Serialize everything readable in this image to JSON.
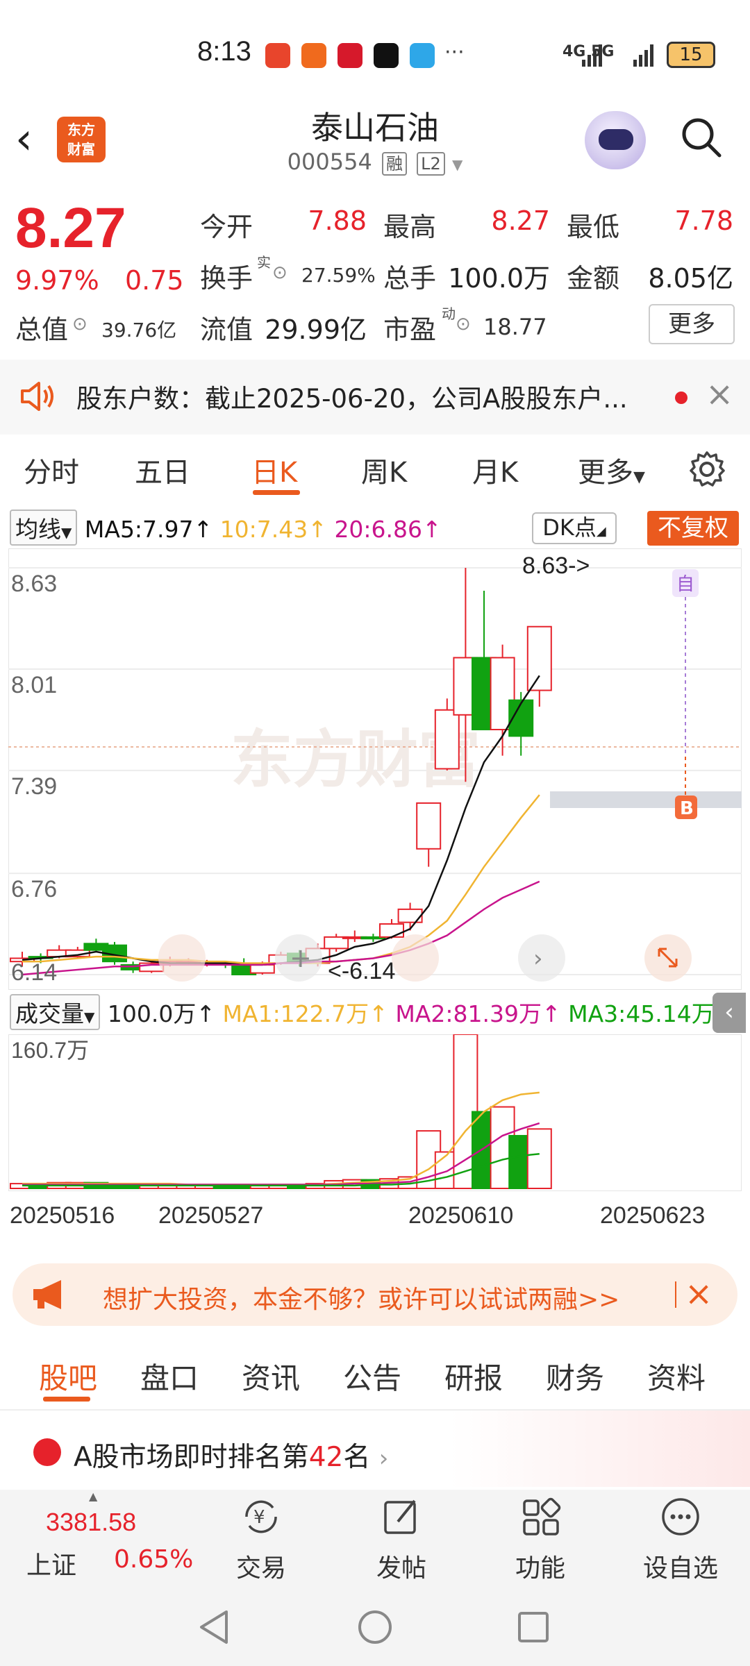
{
  "status_bar": {
    "time": "8:13",
    "network": "4G 5G",
    "battery": "15"
  },
  "header": {
    "stock_name": "泰山石油",
    "stock_code": "000554",
    "tag1": "融",
    "tag2": "L2",
    "logo_line1": "东方",
    "logo_line2": "财富"
  },
  "quote": {
    "price": "8.27",
    "change_pct": "9.97%",
    "change": "0.75",
    "open_label": "今开",
    "open": "7.88",
    "high_label": "最高",
    "high": "8.27",
    "low_label": "最低",
    "low": "7.78",
    "turnover_label": "换手",
    "turnover_sup": "实",
    "turnover": "27.59%",
    "volume_label": "总手",
    "volume": "100.0万",
    "amount_label": "金额",
    "amount": "8.05亿",
    "mktcap_label": "总值",
    "mktcap": "39.76亿",
    "float_label": "流值",
    "float_cap": "29.99亿",
    "pe_label": "市盈",
    "pe_sup": "动",
    "pe": "18.77",
    "more_label": "更多"
  },
  "notice": {
    "text": "股东户数：截止2025-06-20，公司A股股东户..."
  },
  "kline_tabs": [
    "分时",
    "五日",
    "日K",
    "周K",
    "月K",
    "更多"
  ],
  "ma_row": {
    "select": "均线",
    "ma5": "MA5:7.97",
    "ma10": "10:7.43",
    "ma20": "20:6.86",
    "dk": "DK点",
    "fuquan": "不复权"
  },
  "colors": {
    "up": "#e6222b",
    "down": "#11a211",
    "ma5": "#111111",
    "ma10": "#f0b431",
    "ma20": "#c8148c",
    "accent": "#ea5a1e"
  },
  "chart_data": {
    "type": "candlestick",
    "y_ticks": [
      "8.63",
      "8.01",
      "7.39",
      "6.76",
      "6.14"
    ],
    "ylim": [
      6.14,
      8.63
    ],
    "max_label": "8.63->",
    "min_label": "<-6.14",
    "buy_marker": "B",
    "self_marker": "自",
    "watermark": "东方财富",
    "x_labels": [
      "20250516",
      "20250527",
      "20250610",
      "20250623"
    ],
    "candles": [
      [
        6.22,
        6.24,
        6.19,
        6.28
      ],
      [
        6.25,
        6.24,
        6.21,
        6.27
      ],
      [
        6.25,
        6.29,
        6.24,
        6.32
      ],
      [
        6.25,
        6.29,
        6.24,
        6.31
      ],
      [
        6.33,
        6.29,
        6.28,
        6.36
      ],
      [
        6.32,
        6.22,
        6.2,
        6.34
      ],
      [
        6.2,
        6.17,
        6.15,
        6.22
      ],
      [
        6.16,
        6.21,
        6.15,
        6.23
      ],
      [
        6.21,
        6.22,
        6.19,
        6.25
      ],
      [
        6.22,
        6.22,
        6.2,
        6.24
      ],
      [
        6.21,
        6.21,
        6.19,
        6.23
      ],
      [
        6.21,
        6.2,
        6.18,
        6.22
      ],
      [
        6.2,
        6.14,
        6.14,
        6.24
      ],
      [
        6.15,
        6.2,
        6.14,
        6.22
      ],
      [
        6.21,
        6.26,
        6.2,
        6.28
      ],
      [
        6.27,
        6.21,
        6.19,
        6.29
      ],
      [
        6.21,
        6.3,
        6.19,
        6.33
      ],
      [
        6.3,
        6.37,
        6.28,
        6.39
      ],
      [
        6.37,
        6.37,
        6.34,
        6.41
      ],
      [
        6.37,
        6.36,
        6.34,
        6.39
      ],
      [
        6.37,
        6.45,
        6.36,
        6.48
      ],
      [
        6.46,
        6.54,
        6.41,
        6.58
      ],
      [
        6.91,
        7.19,
        6.8,
        7.19
      ],
      [
        7.4,
        7.76,
        7.39,
        7.83
      ],
      [
        7.73,
        8.08,
        7.32,
        8.63
      ],
      [
        8.08,
        7.64,
        7.68,
        8.49
      ],
      [
        7.64,
        8.08,
        7.48,
        8.16
      ],
      [
        7.82,
        7.6,
        7.48,
        7.87
      ],
      [
        7.88,
        8.27,
        7.78,
        8.27
      ]
    ],
    "ma5": [
      6.23,
      6.24,
      6.25,
      6.26,
      6.28,
      6.26,
      6.24,
      6.22,
      6.21,
      6.21,
      6.21,
      6.21,
      6.2,
      6.2,
      6.21,
      6.22,
      6.23,
      6.26,
      6.31,
      6.33,
      6.37,
      6.42,
      6.56,
      6.84,
      7.16,
      7.44,
      7.6,
      7.8,
      7.97
    ],
    "ma10": [
      6.22,
      6.22,
      6.23,
      6.24,
      6.25,
      6.25,
      6.24,
      6.23,
      6.23,
      6.23,
      6.22,
      6.22,
      6.21,
      6.21,
      6.21,
      6.21,
      6.21,
      6.22,
      6.23,
      6.24,
      6.27,
      6.31,
      6.38,
      6.47,
      6.63,
      6.8,
      6.95,
      7.1,
      7.24
    ],
    "ma20": [
      6.14,
      6.15,
      6.16,
      6.17,
      6.18,
      6.19,
      6.19,
      6.2,
      6.2,
      6.2,
      6.2,
      6.2,
      6.2,
      6.2,
      6.21,
      6.21,
      6.22,
      6.22,
      6.23,
      6.24,
      6.26,
      6.29,
      6.33,
      6.38,
      6.46,
      6.54,
      6.61,
      6.66,
      6.71
    ]
  },
  "volume_row": {
    "select": "成交量",
    "value": "100.0万",
    "ma1": "MA1:122.7万",
    "ma2": "MA2:81.39万",
    "ma3": "MA3:45.14万"
  },
  "volume_data": {
    "max_label": "160.7万",
    "values": [
      5,
      5,
      6,
      6,
      6,
      5,
      5,
      4,
      4,
      4,
      4,
      4,
      4,
      4,
      4,
      4,
      5,
      8,
      9,
      9,
      10,
      12,
      60,
      38,
      160.7,
      80,
      85,
      55,
      62
    ],
    "ma1": [
      5,
      5,
      5,
      5,
      5,
      5,
      5,
      5,
      5,
      4,
      4,
      4,
      4,
      4,
      4,
      4,
      4,
      5,
      6,
      7,
      8,
      10,
      20,
      35,
      60,
      80,
      92,
      98,
      100
    ],
    "ma2": [
      4,
      4,
      4,
      4,
      4,
      4,
      4,
      4,
      4,
      4,
      4,
      4,
      4,
      4,
      4,
      4,
      4,
      4,
      5,
      5,
      6,
      7,
      12,
      18,
      30,
      42,
      55,
      62,
      68
    ],
    "ma3": [
      3,
      3,
      3,
      3,
      3,
      3,
      3,
      3,
      3,
      3,
      3,
      3,
      3,
      3,
      3,
      3,
      3,
      3,
      3,
      4,
      4,
      5,
      8,
      12,
      18,
      24,
      30,
      34,
      36
    ]
  },
  "promo": {
    "text": "想扩大投资，本金不够？或许可以试试两融>>"
  },
  "section_tabs": [
    "股吧",
    "盘口",
    "资讯",
    "公告",
    "研报",
    "财务",
    "资料"
  ],
  "rank": {
    "prefix": "A股市场即时排名第",
    "num": "42",
    "suffix": "名"
  },
  "bottom_bar": {
    "index_value": "3381.58",
    "index_name": "上证",
    "index_pct": "0.65%",
    "items": [
      "交易",
      "发帖",
      "功能",
      "设自选"
    ]
  }
}
